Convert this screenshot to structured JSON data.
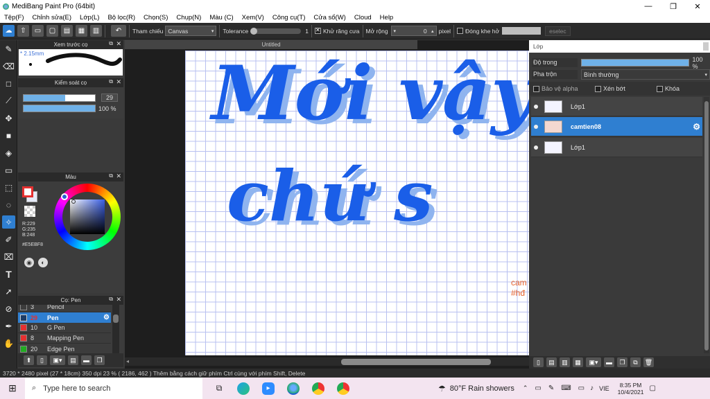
{
  "window": {
    "title": "MediBang Paint Pro (64bit)",
    "minimize": "—",
    "maximize": "❐",
    "close": "✕"
  },
  "menu": [
    "Tệp(F)",
    "Chỉnh sửa(E)",
    "Lớp(L)",
    "Bộ lọc(R)",
    "Chọn(S)",
    "Chụp(N)",
    "Màu (C)",
    "Xem(V)",
    "Công cụ(T)",
    "Cửa sổ(W)",
    "Cloud",
    "Help"
  ],
  "toolbar": {
    "undo": "↶",
    "reference_label": "Tham chiếu",
    "reference_value": "Canvas",
    "tolerance_label": "Tolerance",
    "tolerance_value": "1",
    "antialias_label": "Khử răng cưa",
    "expand_label": "Mở rộng",
    "expand_value": "0",
    "expand_unit": "pixel",
    "close_gap_label": "Đóng khe hở",
    "select_btn": "eselec"
  },
  "preview_panel": {
    "title": "Xem trước cọ",
    "size_text": "* 2.15mm"
  },
  "brush_control": {
    "title": "Kiểm soát cọ",
    "size_value": "29",
    "opacity_value": "100 %",
    "size_fill": 0.58,
    "opacity_fill": 1.0
  },
  "color_panel": {
    "title": "Màu",
    "r": "R:229",
    "g": "G:235",
    "b": "B:248",
    "hex": "#E5EBF8"
  },
  "brush_panel": {
    "title": "Cọ: Pen",
    "items": [
      {
        "num": "3",
        "name": "Pencil",
        "color": "#3c3c3c"
      },
      {
        "num": "29",
        "name": "Pen",
        "color": "#2a5fa8",
        "selected": true
      },
      {
        "num": "10",
        "name": "G Pen",
        "color": "#e53030"
      },
      {
        "num": "8",
        "name": "Mapping Pen",
        "color": "#e53030"
      },
      {
        "num": "20",
        "name": "Edge Pen",
        "color": "#22aa22"
      }
    ]
  },
  "canvas": {
    "tab": "Untitled",
    "text_line1": "Mới vậy",
    "text_line2": "chứ s",
    "watermark1": "cam",
    "watermark2": "#hđ"
  },
  "layer_panel": {
    "title": "Lớp",
    "opacity_label": "Độ trong",
    "opacity_value": "100 %",
    "opacity_fill": 1.0,
    "blend_label": "Pha trộn",
    "blend_value": "Bình thường",
    "protect_alpha": "Bảo vệ alpha",
    "clipping": "Xén bớt",
    "lock": "Khóa",
    "layers": [
      {
        "name": "Lớp1",
        "selected": false
      },
      {
        "name": "camtien08",
        "selected": true
      },
      {
        "name": "Lớp1",
        "selected": false
      }
    ]
  },
  "status": {
    "text": "3720 * 2480 pixel   (27 * 18cm)   350 dpi   23 %   ( 2186, 462 )   Thêm bằng cách giữ phím Ctrl cùng với phím Shift, Delete"
  },
  "taskbar": {
    "search": "Type here to search",
    "weather": "80°F  Rain showers",
    "lang": "VIE",
    "time": "8:35 PM",
    "date": "10/4/2021"
  },
  "colors": {
    "accent": "#2f7fd1",
    "ink": "#1a5ee8",
    "shadow": "#8fb4ef",
    "watermark": "#e8622a"
  }
}
